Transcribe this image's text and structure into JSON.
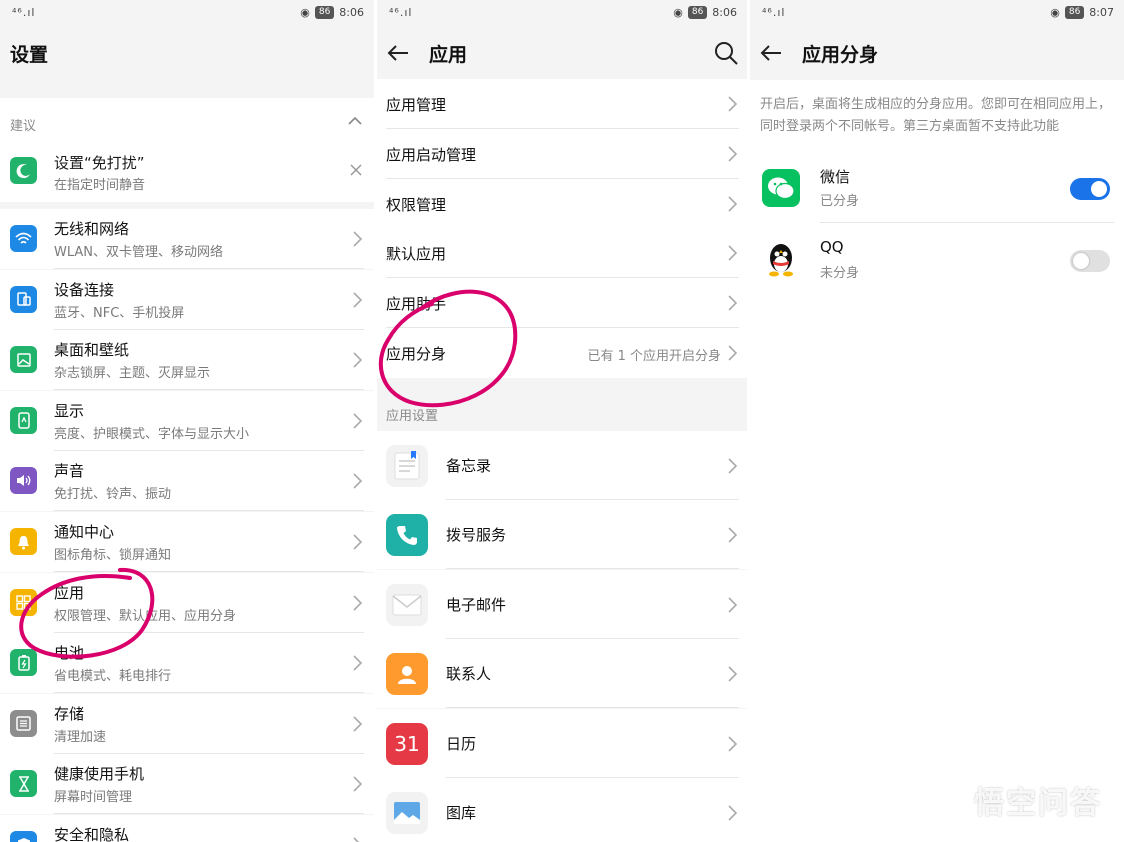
{
  "colors": {
    "accent": "#1a73e8",
    "annotation": "#d9006c",
    "toggle_off": "#e0e0e0"
  },
  "panel1": {
    "status": {
      "signal": "⁴⁶.ıl",
      "battery": "86",
      "time": "8:06"
    },
    "title": "设置",
    "suggest": {
      "label": "建议",
      "item_title": "设置“免打扰”",
      "item_subtitle": "在指定时间静音"
    },
    "items": [
      {
        "icon": "wifi-icon",
        "color": "#1e88e5",
        "title": "无线和网络",
        "subtitle": "WLAN、双卡管理、移动网络"
      },
      {
        "icon": "device-connect-icon",
        "color": "#1e88e5",
        "title": "设备连接",
        "subtitle": "蓝牙、NFC、手机投屏"
      },
      {
        "icon": "wallpaper-icon",
        "color": "#21b36b",
        "title": "桌面和壁纸",
        "subtitle": "杂志锁屏、主题、灭屏显示"
      },
      {
        "icon": "display-icon",
        "color": "#21b36b",
        "title": "显示",
        "subtitle": "亮度、护眼模式、字体与显示大小"
      },
      {
        "icon": "sound-icon",
        "color": "#7e57c2",
        "title": "声音",
        "subtitle": "免打扰、铃声、振动"
      },
      {
        "icon": "bell-icon",
        "color": "#f5b400",
        "title": "通知中心",
        "subtitle": "图标角标、锁屏通知"
      },
      {
        "icon": "apps-icon",
        "color": "#f5b400",
        "title": "应用",
        "subtitle": "权限管理、默认应用、应用分身"
      },
      {
        "icon": "battery-icon",
        "color": "#21b36b",
        "title": "电池",
        "subtitle": "省电模式、耗电排行"
      },
      {
        "icon": "storage-icon",
        "color": "#8d8d8d",
        "title": "存储",
        "subtitle": "清理加速"
      },
      {
        "icon": "hourglass-icon",
        "color": "#21b36b",
        "title": "健康使用手机",
        "subtitle": "屏幕时间管理"
      },
      {
        "icon": "security-icon",
        "color": "#1e88e5",
        "title": "安全和隐私",
        "subtitle": ""
      }
    ]
  },
  "panel2": {
    "status": {
      "signal": "⁴⁶.ıl",
      "battery": "86",
      "time": "8:06"
    },
    "title": "应用",
    "menu": [
      {
        "title": "应用管理",
        "extra": ""
      },
      {
        "title": "应用启动管理",
        "extra": ""
      },
      {
        "title": "权限管理",
        "extra": ""
      },
      {
        "title": "默认应用",
        "extra": ""
      },
      {
        "title": "应用助手",
        "extra": ""
      },
      {
        "title": "应用分身",
        "extra": "已有 1 个应用开启分身"
      }
    ],
    "section_label": "应用设置",
    "apps": [
      {
        "icon": "memo-icon",
        "title": "备忘录"
      },
      {
        "icon": "phone-icon",
        "title": "拨号服务"
      },
      {
        "icon": "mail-icon",
        "title": "电子邮件"
      },
      {
        "icon": "contacts-icon",
        "title": "联系人"
      },
      {
        "icon": "calendar-icon",
        "title": "日历",
        "icon_text": "31"
      },
      {
        "icon": "gallery-icon",
        "title": "图库"
      }
    ]
  },
  "panel3": {
    "status": {
      "signal": "⁴⁶.ıl",
      "battery": "86",
      "time": "8:07"
    },
    "title": "应用分身",
    "description": "开启后，桌面将生成相应的分身应用。您即可在相同应用上，同时登录两个不同帐号。第三方桌面暂不支持此功能",
    "apps": [
      {
        "icon": "wechat-icon",
        "title": "微信",
        "subtitle": "已分身",
        "enabled": true
      },
      {
        "icon": "qq-icon",
        "title": "QQ",
        "subtitle": "未分身",
        "enabled": false
      }
    ]
  },
  "watermark": "悟空问答"
}
